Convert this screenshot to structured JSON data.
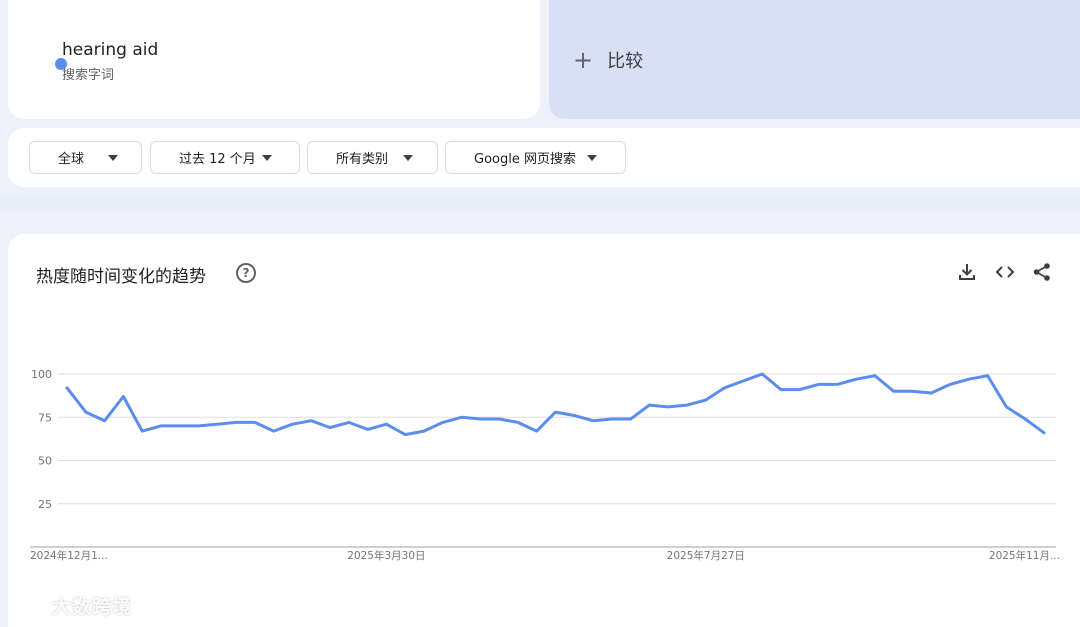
{
  "search_term": {
    "name": "hearing aid",
    "type_label": "搜索字词",
    "color": "#5b8def"
  },
  "compare": {
    "label": "比较"
  },
  "filters": {
    "region": "全球",
    "time_range": "过去 12 个月",
    "category": "所有类别",
    "search_type": "Google 网页搜索"
  },
  "chart_panel": {
    "title": "热度随时间变化的趋势",
    "icons": [
      "help-icon",
      "download-icon",
      "embed-code-icon",
      "share-icon"
    ]
  },
  "watermark": "大数跨境",
  "chart_data": {
    "type": "line",
    "title": "",
    "xlabel": "",
    "ylabel": "",
    "ylim": [
      0,
      100
    ],
    "yticks": [
      25,
      50,
      75,
      100
    ],
    "grid": true,
    "x_tick_labels": [
      "2024年12月1...",
      "2025年3月30日",
      "2025年7月27日",
      "2025年11月..."
    ],
    "x_tick_indices": [
      0,
      17,
      34,
      51
    ],
    "series": [
      {
        "name": "hearing aid",
        "color": "#5b8def",
        "values": [
          92,
          78,
          73,
          87,
          67,
          70,
          70,
          70,
          71,
          72,
          72,
          67,
          71,
          73,
          69,
          72,
          68,
          71,
          65,
          67,
          72,
          75,
          74,
          74,
          72,
          67,
          78,
          76,
          73,
          74,
          74,
          82,
          81,
          82,
          85,
          92,
          96,
          100,
          91,
          91,
          94,
          94,
          97,
          99,
          90,
          90,
          89,
          94,
          97,
          99,
          81,
          74,
          66
        ]
      }
    ]
  }
}
